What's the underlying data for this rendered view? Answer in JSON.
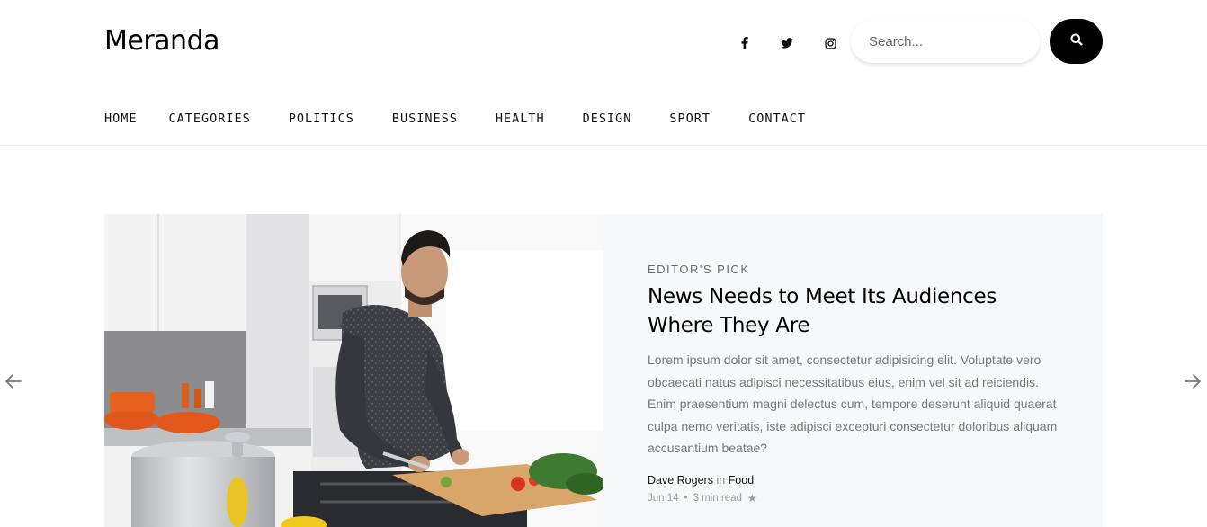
{
  "site": {
    "logo": "Meranda"
  },
  "header": {
    "social": [
      {
        "icon": "facebook-icon"
      },
      {
        "icon": "twitter-icon"
      },
      {
        "icon": "instagram-icon"
      }
    ],
    "search": {
      "placeholder": "Search...",
      "value": ""
    },
    "search_button_icon": "search-icon"
  },
  "nav": {
    "items": [
      {
        "label": "HOME"
      },
      {
        "label": "CATEGORIES"
      },
      {
        "label": "POLITICS"
      },
      {
        "label": "BUSINESS"
      },
      {
        "label": "HEALTH"
      },
      {
        "label": "DESIGN"
      },
      {
        "label": "SPORT"
      },
      {
        "label": "CONTACT"
      }
    ]
  },
  "featured": {
    "kicker": "EDITOR'S PICK",
    "title": "News Needs to Meet Its Audiences Where They Are",
    "excerpt": "Lorem ipsum dolor sit amet, consectetur adipisicing elit. Voluptate vero obcaecati natus adipisci necessitatibus eius, enim vel sit ad reiciendis. Enim praesentium magni delectus cum, tempore deserunt aliquid quaerat culpa nemo veritatis, iste adipisci excepturi consectetur doloribus aliquam accusantium beatae?",
    "author": "Dave Rogers",
    "in_word": "in",
    "category": "Food",
    "date": "Jun 14",
    "separator": "•",
    "read_time": "3 min read",
    "star_icon": "star-icon"
  },
  "slider": {
    "prev_icon": "arrow-left-icon",
    "next_icon": "arrow-right-icon"
  },
  "colors": {
    "accent": "#000000",
    "panel_bg": "#f7f8f9",
    "muted_text": "#777777"
  }
}
